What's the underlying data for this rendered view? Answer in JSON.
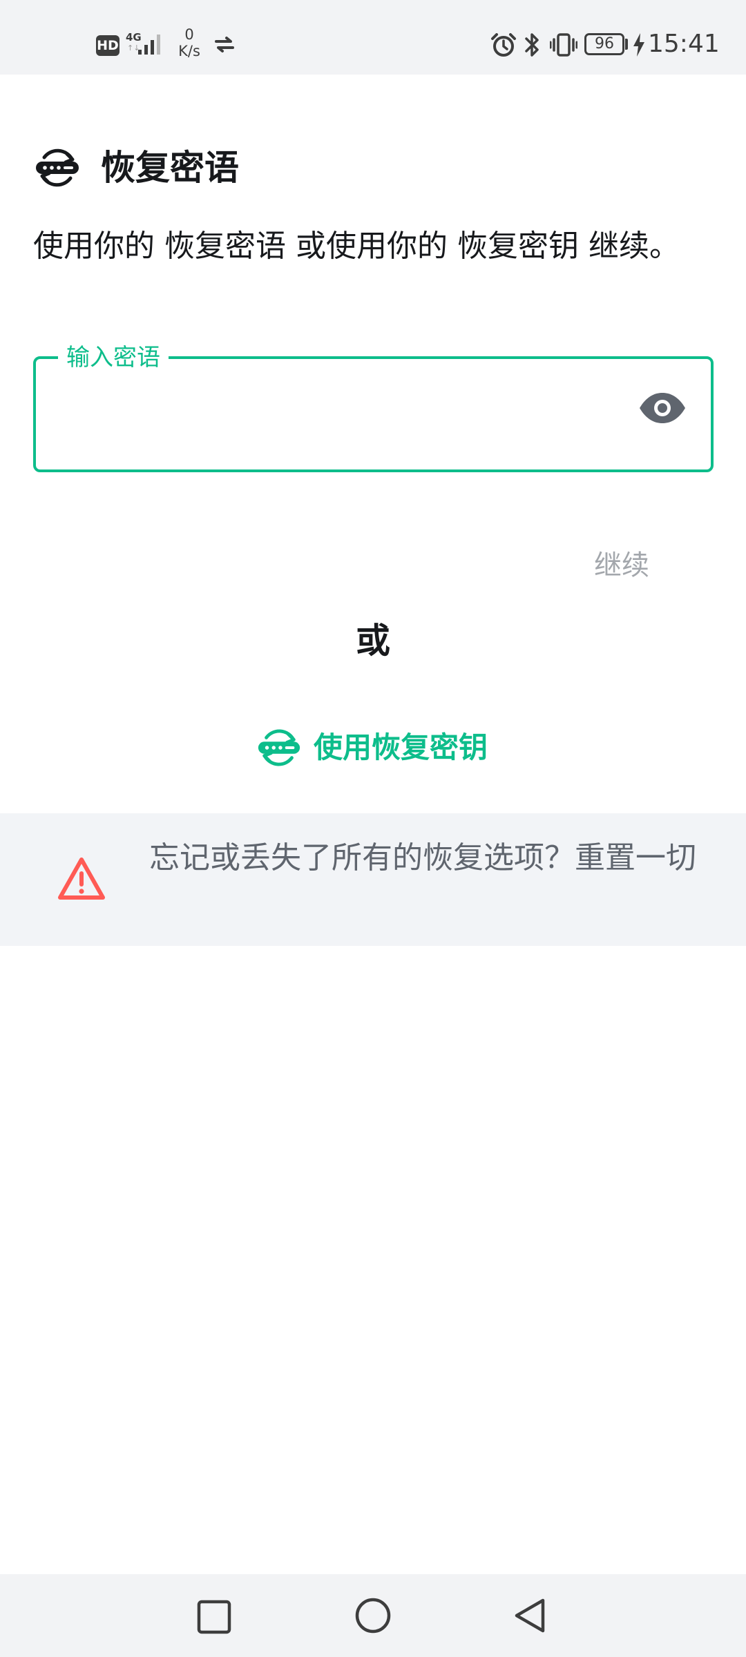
{
  "status_bar": {
    "hd": "HD",
    "network": "4G",
    "network_sub": "↑↓",
    "speed_value": "0",
    "speed_unit": "K/s",
    "battery": "96",
    "time": "15:41"
  },
  "header": {
    "title": "恢复密语"
  },
  "description": "使用你的 恢复密语 或使用你的 恢复密钥 继续。",
  "passphrase_field": {
    "label": "输入密语",
    "value": ""
  },
  "continue_label": "继续",
  "or_label": "或",
  "use_key_label": "使用恢复密钥",
  "reset": {
    "text": "忘记或丢失了所有的恢复选项？重置一切"
  },
  "colors": {
    "accent": "#0dbd8b",
    "warning": "#ff5b55",
    "muted": "#a3a7ac",
    "banner": "#f2f4f7"
  },
  "icons": {
    "title": "recovery-key-icon",
    "visibility": "eye-icon",
    "warning": "warning-triangle-icon",
    "nav": [
      "square-icon",
      "circle-icon",
      "triangle-back-icon"
    ]
  }
}
